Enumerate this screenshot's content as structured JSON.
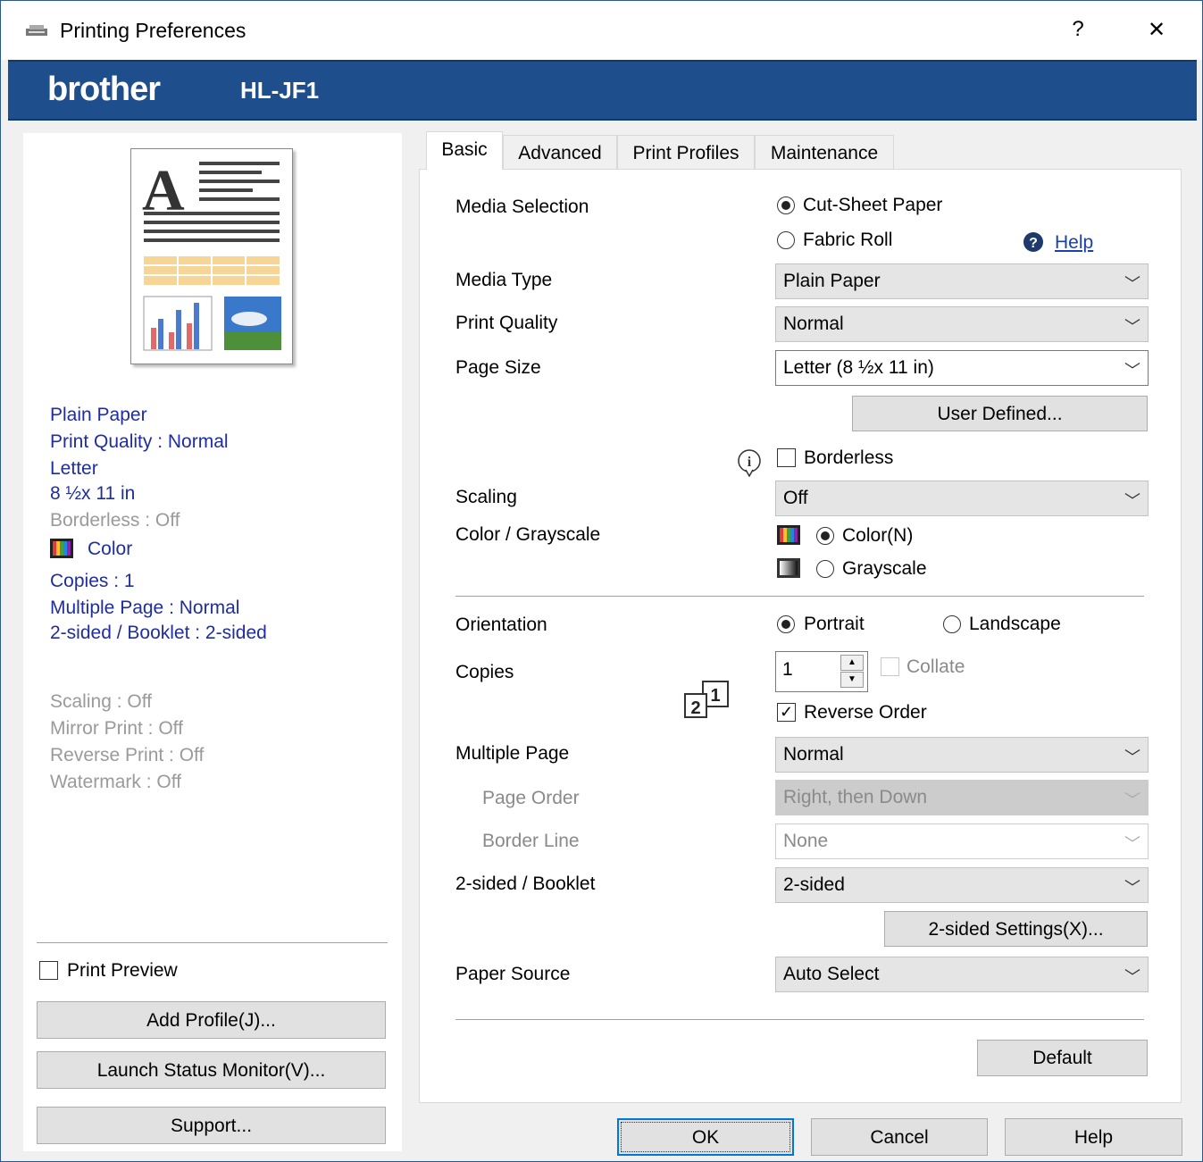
{
  "window": {
    "title": "Printing Preferences",
    "help_label": "?",
    "close_label": "✕"
  },
  "banner": {
    "brand": "brother",
    "model": "HL-JF1"
  },
  "summary": {
    "media": "Plain Paper",
    "quality": "Print Quality : Normal",
    "size": "Letter",
    "dimensions": "8 ½x 11 in",
    "borderless": "Borderless : Off",
    "color": "Color",
    "copies": "Copies : 1",
    "multiple_page": "Multiple Page : Normal",
    "two_sided": "2-sided / Booklet : 2-sided",
    "scaling": "Scaling : Off",
    "mirror": "Mirror Print : Off",
    "reverse": "Reverse Print : Off",
    "watermark": "Watermark : Off"
  },
  "left_actions": {
    "print_preview": "Print Preview",
    "add_profile": "Add Profile(J)...",
    "status_monitor": "Launch Status Monitor(V)...",
    "support": "Support..."
  },
  "tabs": [
    "Basic",
    "Advanced",
    "Print Profiles",
    "Maintenance"
  ],
  "basic": {
    "media_selection_label": "Media Selection",
    "cut_sheet": "Cut-Sheet Paper",
    "fabric_roll": "Fabric Roll",
    "help_link": "Help",
    "media_type_label": "Media Type",
    "media_type_value": "Plain Paper",
    "print_quality_label": "Print Quality",
    "print_quality_value": "Normal",
    "page_size_label": "Page Size",
    "page_size_value": "Letter (8 ½x 11 in)",
    "user_defined": "User Defined...",
    "borderless": "Borderless",
    "scaling_label": "Scaling",
    "scaling_value": "Off",
    "color_label": "Color / Grayscale",
    "color_option": "Color(N)",
    "grayscale_option": "Grayscale",
    "orientation_label": "Orientation",
    "portrait": "Portrait",
    "landscape": "Landscape",
    "copies_label": "Copies",
    "copies_value": "1",
    "collate": "Collate",
    "reverse_order": "Reverse Order",
    "multiple_page_label": "Multiple Page",
    "multiple_page_value": "Normal",
    "page_order_label": "Page Order",
    "page_order_value": "Right, then Down",
    "border_line_label": "Border Line",
    "border_line_value": "None",
    "two_sided_label": "2-sided / Booklet",
    "two_sided_value": "2-sided",
    "two_sided_settings": "2-sided Settings(X)...",
    "paper_source_label": "Paper Source",
    "paper_source_value": "Auto Select",
    "default": "Default",
    "collate_icon_a": "1",
    "collate_icon_b": "2"
  },
  "footer": {
    "ok": "OK",
    "cancel": "Cancel",
    "help": "Help"
  },
  "icons": [
    "printer-icon",
    "help-circle-icon",
    "info-icon",
    "color-swatch-icon",
    "grayscale-swatch-icon",
    "chevron-down-icon",
    "spin-up-icon",
    "spin-down-icon",
    "collate-icon"
  ],
  "colors": {
    "banner": "#1f4e8c",
    "summary_text": "#1f2d9f",
    "link": "#1a3fb0"
  }
}
